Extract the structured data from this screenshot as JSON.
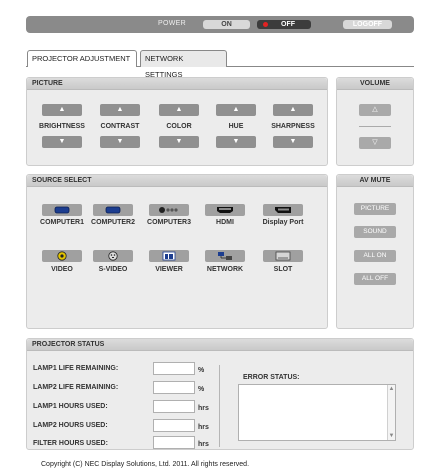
{
  "topbar": {
    "power_label": "POWER",
    "on_label": "ON",
    "off_label": "OFF",
    "logoff_label": "LOGOFF"
  },
  "tabs": [
    {
      "label": "PROJECTOR ADJUSTMENT"
    },
    {
      "label": "NETWORK SETTINGS"
    }
  ],
  "picture": {
    "title": "PICTURE",
    "controls": [
      {
        "label": "BRIGHTNESS"
      },
      {
        "label": "CONTRAST"
      },
      {
        "label": "COLOR"
      },
      {
        "label": "HUE"
      },
      {
        "label": "SHARPNESS"
      }
    ],
    "up_glyph": "▲",
    "down_glyph": "▼"
  },
  "volume": {
    "title": "VOLUME",
    "up_glyph": "△",
    "down_glyph": "▽"
  },
  "source": {
    "title": "SOURCE SELECT",
    "row1": [
      {
        "label": "COMPUTER1",
        "icon": "vga-icon"
      },
      {
        "label": "COMPUTER2",
        "icon": "vga-icon"
      },
      {
        "label": "COMPUTER3",
        "icon": "component-icon"
      },
      {
        "label": "HDMI",
        "icon": "hdmi-icon"
      },
      {
        "label": "Display Port",
        "icon": "displayport-icon"
      }
    ],
    "row2": [
      {
        "label": "VIDEO",
        "icon": "rca-icon"
      },
      {
        "label": "S-VIDEO",
        "icon": "svideo-icon"
      },
      {
        "label": "VIEWER",
        "icon": "viewer-icon"
      },
      {
        "label": "NETWORK",
        "icon": "network-icon"
      },
      {
        "label": "SLOT",
        "icon": "slot-icon"
      }
    ]
  },
  "avmute": {
    "title": "AV MUTE",
    "buttons": [
      "PICTURE",
      "SOUND",
      "ALL ON",
      "ALL OFF"
    ]
  },
  "status": {
    "title": "PROJECTOR STATUS",
    "rows": [
      {
        "label": "LAMP1 LIFE REMAINING:",
        "value": "",
        "unit": "%"
      },
      {
        "label": "LAMP2 LIFE REMAINING:",
        "value": "",
        "unit": "%"
      },
      {
        "label": "LAMP1 HOURS USED:",
        "value": "",
        "unit": "hrs"
      },
      {
        "label": "LAMP2 HOURS USED:",
        "value": "",
        "unit": "hrs"
      },
      {
        "label": "FILTER HOURS USED:",
        "value": "",
        "unit": "hrs"
      }
    ],
    "error_label": "ERROR STATUS:",
    "error_value": ""
  },
  "footer": {
    "copyright": "Copyright (C) NEC Display Solutions, Ltd. 2011. All rights reserved."
  },
  "colors": {
    "header_bar": "#8a8a8a",
    "off_indicator": "#e32222",
    "button_gray": "#909090",
    "panel_bg": "#ececec"
  }
}
